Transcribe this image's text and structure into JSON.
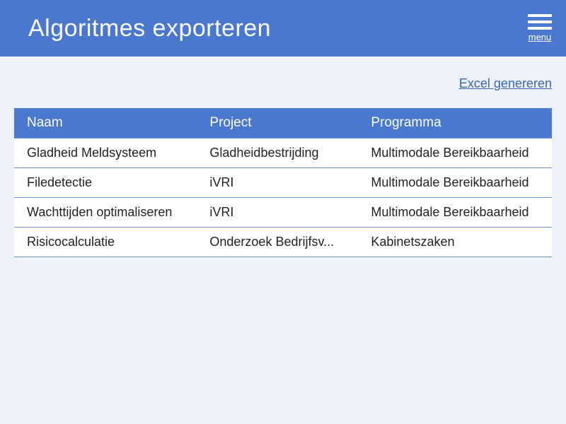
{
  "header": {
    "title": "Algoritmes exporteren",
    "menu_label": "menu"
  },
  "actions": {
    "generate_excel": "Excel genereren"
  },
  "table": {
    "columns": {
      "naam": "Naam",
      "project": "Project",
      "programma": "Programma"
    },
    "rows": [
      {
        "naam": "Gladheid Meldsysteem",
        "project": "Gladheidbestrijding",
        "programma": "Multimodale Bereikbaarheid"
      },
      {
        "naam": "Filedetectie",
        "project": "iVRI",
        "programma": "Multimodale Bereikbaarheid"
      },
      {
        "naam": "Wachttijden optimaliseren",
        "project": "iVRI",
        "programma": "Multimodale Bereikbaarheid"
      },
      {
        "naam": "Risicocalculatie",
        "project": "Onderzoek Bedrijfsv...",
        "programma": "Kabinetszaken"
      }
    ]
  }
}
